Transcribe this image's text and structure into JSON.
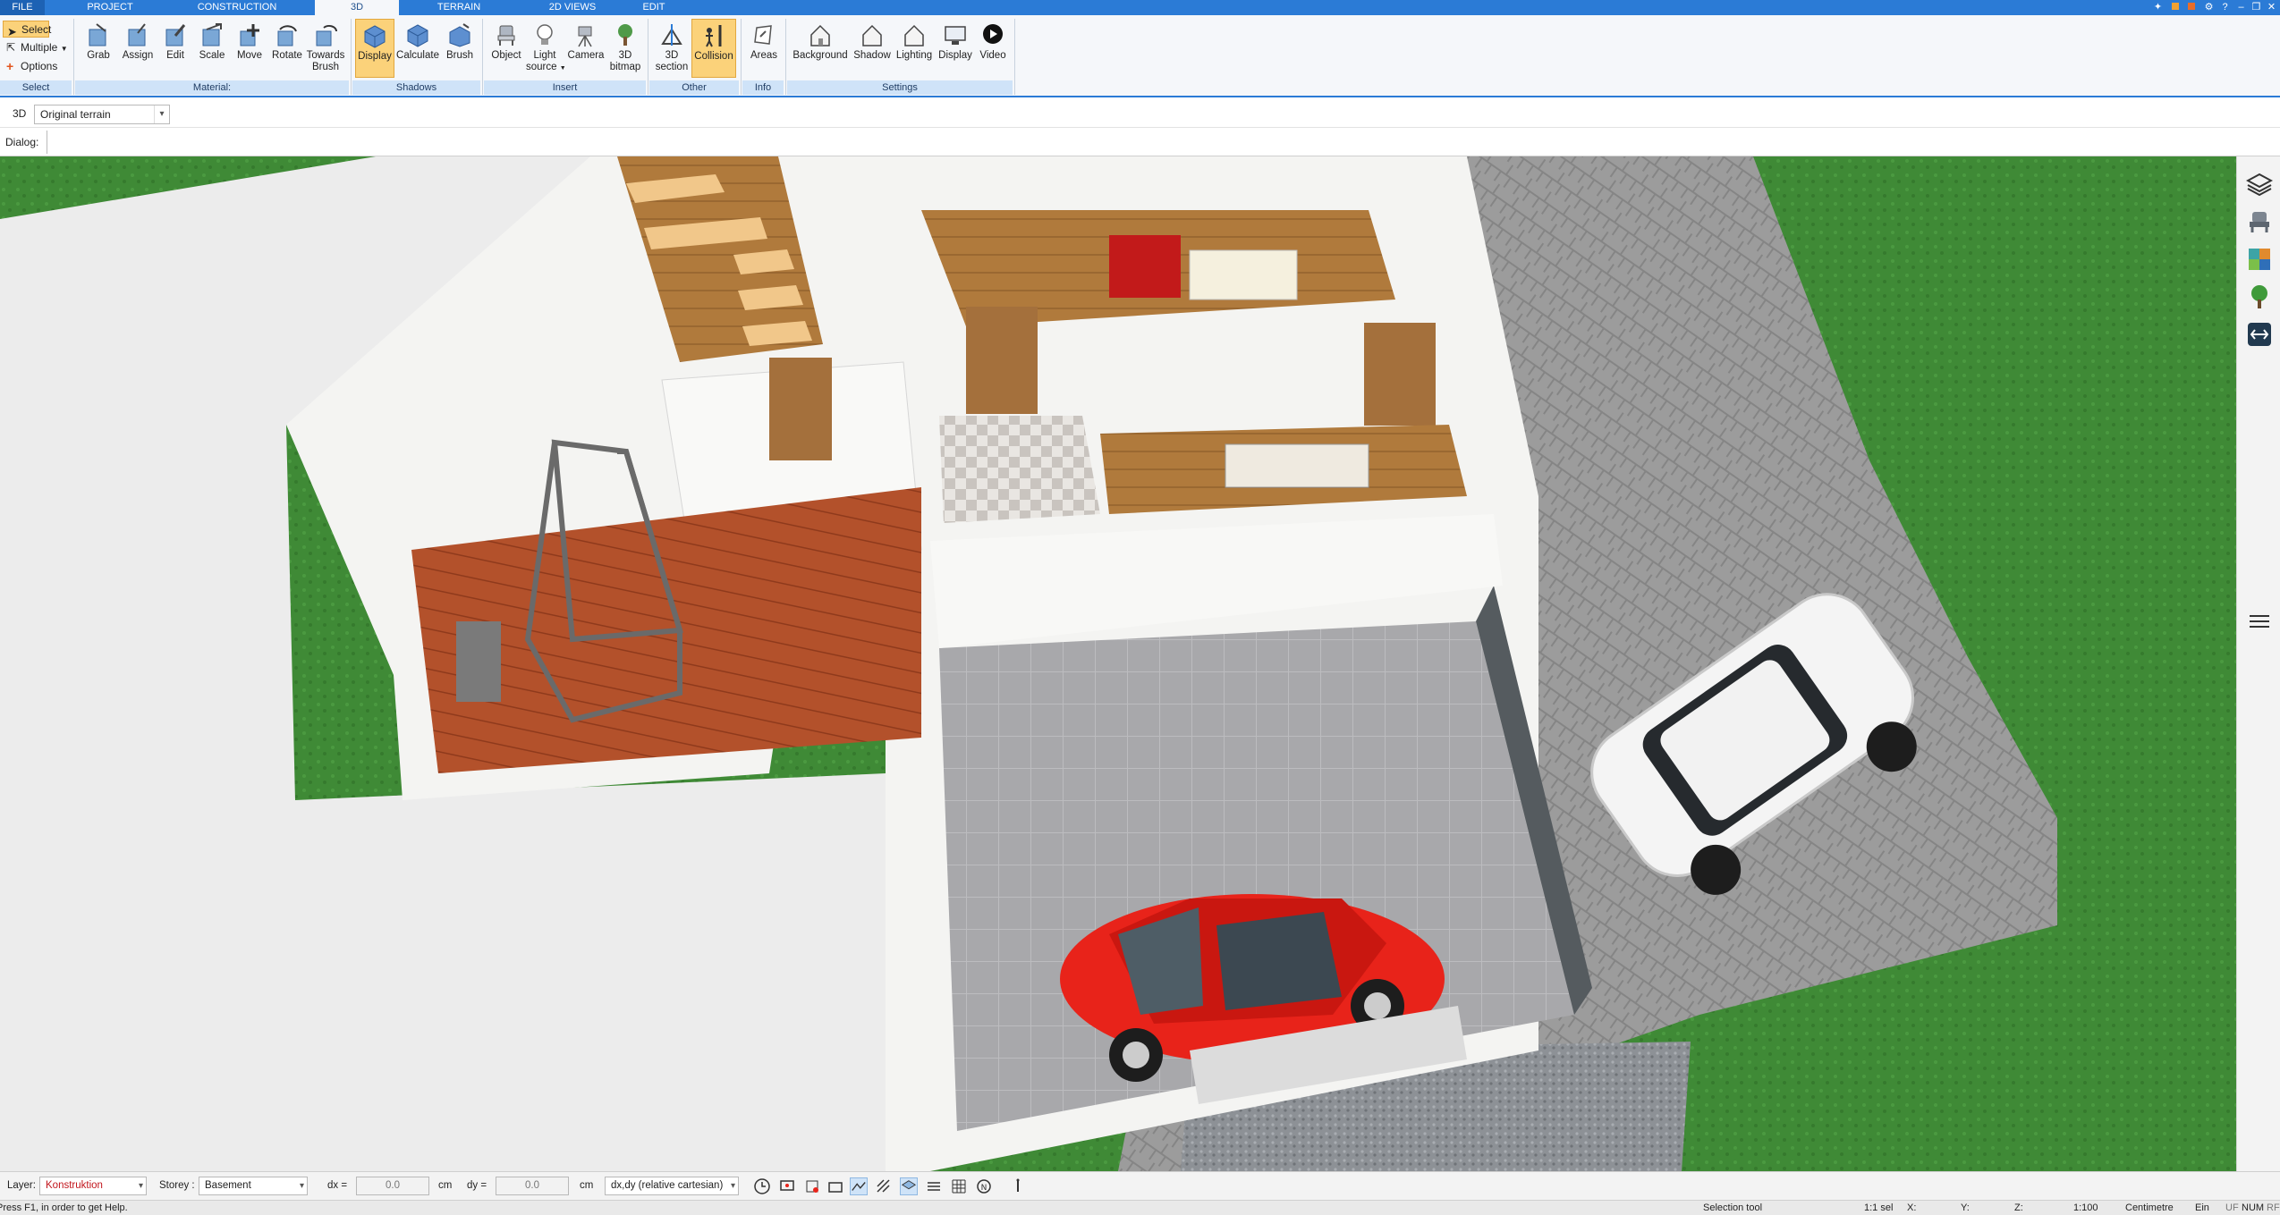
{
  "tabs": [
    "FILE",
    "PROJECT",
    "CONSTRUCTION",
    "3D",
    "TERRAIN",
    "2D VIEWS",
    "EDIT"
  ],
  "active_tab": "3D",
  "ribbon": {
    "select": {
      "select": "Select",
      "multiple": "Multiple",
      "options": "Options",
      "group": "Select"
    },
    "material": {
      "grab": "Grab",
      "assign": "Assign",
      "edit": "Edit",
      "scale": "Scale",
      "move": "Move",
      "rotate": "Rotate",
      "towards1": "Towards",
      "towards2": "Brush",
      "group": "Material:"
    },
    "shadows": {
      "display": "Display",
      "calculate": "Calculate",
      "brush": "Brush",
      "group": "Shadows"
    },
    "insert": {
      "object": "Object",
      "light1": "Light",
      "light2": "source",
      "camera": "Camera",
      "bitmap1": "3D",
      "bitmap2": "bitmap",
      "group": "Insert"
    },
    "other": {
      "section1": "3D",
      "section2": "section",
      "collision": "Collision",
      "group": "Other"
    },
    "info": {
      "areas": "Areas",
      "group": "Info"
    },
    "settings": {
      "background": "Background",
      "shadow": "Shadow",
      "lighting": "Lighting",
      "display": "Display",
      "video": "Video",
      "group": "Settings"
    }
  },
  "view_row": {
    "label": "3D",
    "terrain_value": "Original terrain"
  },
  "dialog_row": {
    "label": "Dialog:"
  },
  "statusbar": {
    "layer_label": "Layer:",
    "layer_value": "Konstruktion",
    "storey_label": "Storey :",
    "storey_value": "Basement",
    "dx_label": "dx =",
    "dx_value": "0.0",
    "dx_unit": "cm",
    "dy_label": "dy =",
    "dy_value": "0.0",
    "dy_unit": "cm",
    "coord_mode": "dx,dy (relative cartesian)"
  },
  "bottombar": {
    "help": "Press F1, in order to get Help.",
    "tool": "Selection tool",
    "sel": "1:1 sel",
    "x": "X:",
    "y": "Y:",
    "z": "Z:",
    "scale": "1:100",
    "unit": "Centimetre",
    "ein": "Ein",
    "uf": "UF",
    "num": "NUM",
    "rf": "RF"
  },
  "colors": {
    "accent": "#2b7bd6",
    "ribbon_active": "#fbd27a",
    "group_bar": "#cfe3f8",
    "grass": "#3f8a36",
    "paving": "#9a9a9a",
    "red_car": "#e8231a",
    "wood_deck": "#b5532d"
  },
  "sidebar_icons": [
    "layers-icon",
    "chair-icon",
    "texture-icon",
    "tree-icon",
    "terrain-icon",
    "menu-icon"
  ]
}
